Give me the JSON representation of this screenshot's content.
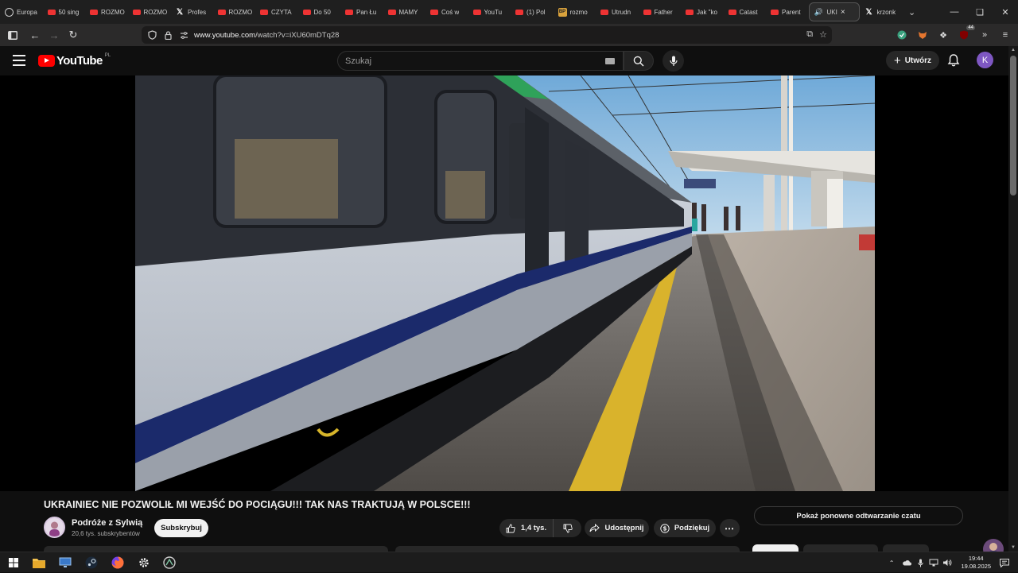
{
  "browser": {
    "tabs": [
      {
        "label": "Europa",
        "icon": "globe-icon"
      },
      {
        "label": "50 sing",
        "icon": "youtube-icon"
      },
      {
        "label": "ROZMO",
        "icon": "youtube-icon"
      },
      {
        "label": "ROZMO",
        "icon": "youtube-icon"
      },
      {
        "label": "Profes",
        "icon": "x-icon"
      },
      {
        "label": "ROZMO",
        "icon": "youtube-icon"
      },
      {
        "label": "CZYTA",
        "icon": "youtube-icon"
      },
      {
        "label": "Do 50",
        "icon": "youtube-icon"
      },
      {
        "label": "Pan Łu",
        "icon": "youtube-icon"
      },
      {
        "label": "MAMY",
        "icon": "youtube-icon"
      },
      {
        "label": "Coś w",
        "icon": "youtube-icon"
      },
      {
        "label": "YouTu",
        "icon": "youtube-icon"
      },
      {
        "label": "(1) Pol",
        "icon": "youtube-icon"
      },
      {
        "label": "rozmo",
        "icon": "bp-icon"
      },
      {
        "label": "Utrudn",
        "icon": "youtube-icon"
      },
      {
        "label": "Father",
        "icon": "youtube-icon"
      },
      {
        "label": "Jak \"ko",
        "icon": "youtube-icon"
      },
      {
        "label": "Catast",
        "icon": "youtube-icon"
      },
      {
        "label": "Parent",
        "icon": "youtube-icon"
      }
    ],
    "active_tab": {
      "label": "UKI",
      "icon": "speaker-icon"
    },
    "after_tab": {
      "label": "krzonk",
      "icon": "x-icon"
    },
    "url_host": "www.youtube.com",
    "url_path": "/watch?v=iXU60mDTq28",
    "extension_badge": "44"
  },
  "youtube": {
    "logo_text": "YouTube",
    "country_code": "PL",
    "search_placeholder": "Szukaj",
    "create_label": "Utwórz",
    "avatar_letter": "K"
  },
  "video": {
    "title": "UKRAINIEC NIE POZWOLIŁ MI WEJŚĆ DO POCIĄGU!!! TAK NAS TRAKTUJĄ W POLSCE!!!",
    "channel_name": "Podróże z Sylwią",
    "subscribers": "20,6 tys. subskrybentów",
    "subscribe_label": "Subskrybuj",
    "likes": "1,4 tys.",
    "share_label": "Udostępnij",
    "thanks_label": "Podziękuj",
    "chat_replay_label": "Pokaż ponowne odtwarzanie czatu"
  },
  "taskbar": {
    "time": "19:44",
    "date": "19.08.2025"
  },
  "colors": {
    "yt_red": "#ff0000",
    "background": "#0f0f0f",
    "pill": "#272727",
    "avatar": "#7e57c2"
  }
}
